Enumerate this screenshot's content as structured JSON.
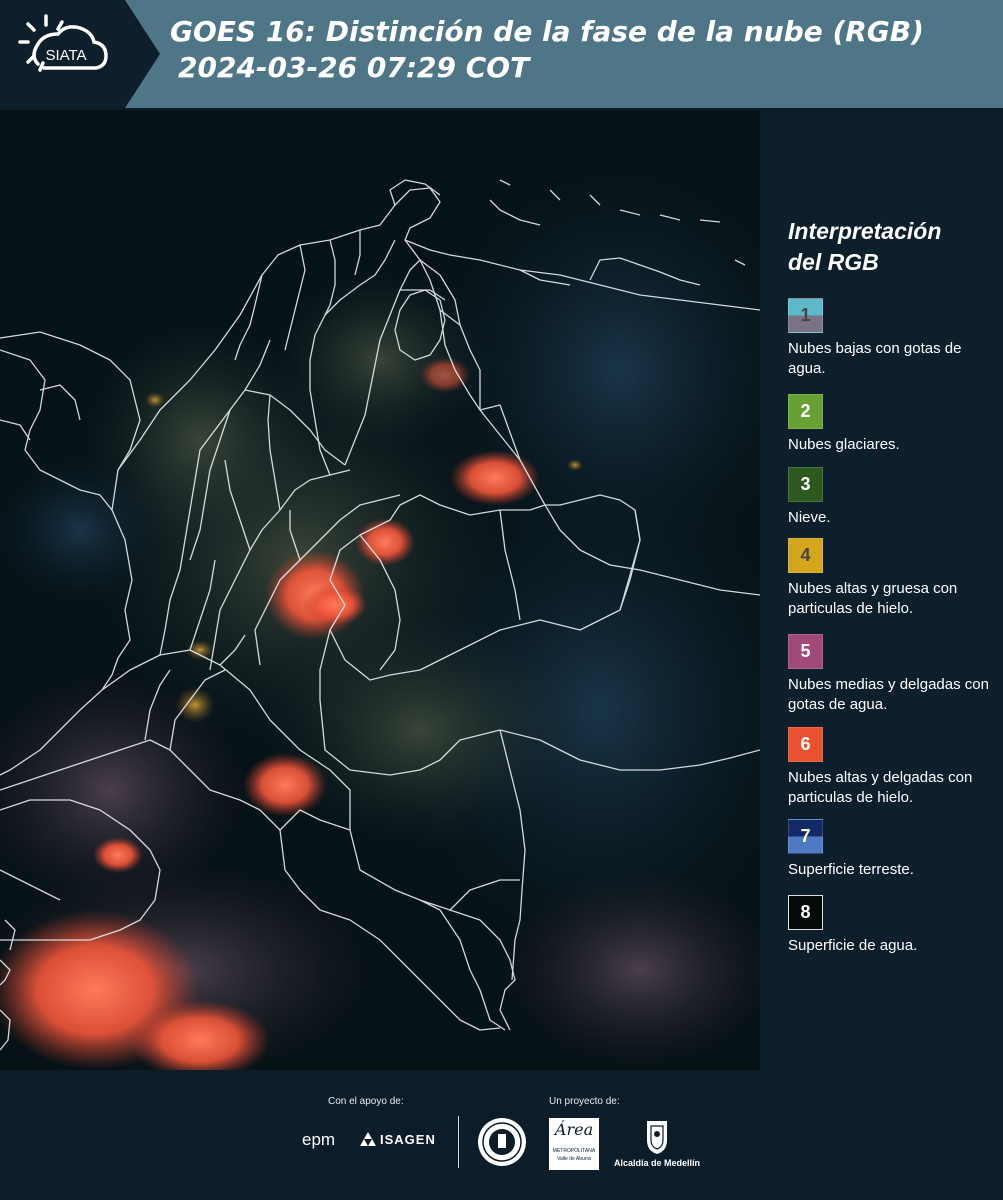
{
  "header": {
    "logo_text": "SIATA",
    "title_line1": "GOES 16: Distinción de la fase de la nube (RGB)",
    "title_line2": "2024-03-26 07:29 COT"
  },
  "legend": {
    "title_line1": "Interpretación",
    "title_line2": "del RGB",
    "items": [
      {
        "number": "1",
        "label": "Nubes bajas con gotas de agua.",
        "color_top": "#5db8c9",
        "color_bottom": "#7a7386",
        "number_color": "#444444"
      },
      {
        "number": "2",
        "label": "Nubes glaciares.",
        "color_top": "#67a133",
        "color_bottom": "#67a133",
        "number_color": "#ffffff"
      },
      {
        "number": "3",
        "label": "Nieve.",
        "color_top": "#2c5a1e",
        "color_bottom": "#2c5a1e",
        "number_color": "#ffffff"
      },
      {
        "number": "4",
        "label": "Nubes altas y gruesa con particulas de hielo.",
        "color_top": "#d5a51c",
        "color_bottom": "#d5a51c",
        "number_color": "#444444"
      },
      {
        "number": "5",
        "label": "Nubes medias y delgadas con gotas de agua.",
        "color_top": "#a04a79",
        "color_bottom": "#a04a79",
        "number_color": "#ffffff"
      },
      {
        "number": "6",
        "label": "Nubes altas y delgadas con particulas de hielo.",
        "color_top": "#e8522f",
        "color_bottom": "#e8522f",
        "number_color": "#ffffff"
      },
      {
        "number": "7",
        "label": "Superficie terreste.",
        "color_top": "#132a66",
        "color_bottom": "#4f79c2",
        "number_color": "#ffffff"
      },
      {
        "number": "8",
        "label": "Superficie de agua.",
        "color_top": "#050a07",
        "color_bottom": "#050a07",
        "number_color": "#ffffff"
      }
    ]
  },
  "footer": {
    "support_label": "Con el apoyo de:",
    "project_label": "Un proyecto de:",
    "epm_text": "epm",
    "isagen_text": "ISAGEN",
    "area_text": "Área",
    "area_sub1": "METROPOLITANA",
    "area_sub2": "Valle de Aburrá",
    "alcaldia_text": "Alcaldía de Medellín"
  }
}
